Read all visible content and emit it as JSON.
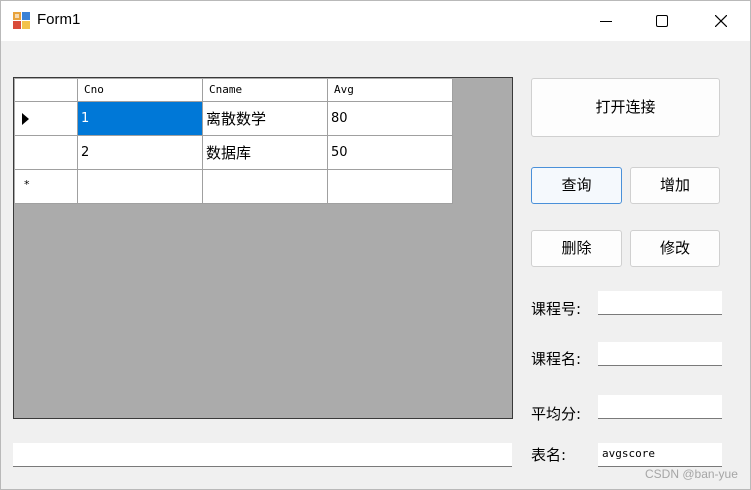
{
  "window": {
    "title": "Form1"
  },
  "titlebar_buttons": {
    "minimize": "minimize-icon",
    "maximize": "maximize-icon",
    "close": "close-icon"
  },
  "grid": {
    "columns": [
      "Cno",
      "Cname",
      "Avg"
    ],
    "rows": [
      {
        "current": true,
        "cells": [
          "1",
          "离散数学",
          "80"
        ]
      },
      {
        "current": false,
        "cells": [
          "2",
          "数据库",
          "50"
        ]
      }
    ],
    "new_row_marker": "*",
    "selected_cell": {
      "row": 0,
      "column": 0
    },
    "colors": {
      "selection": "#0078d7",
      "background": "#ababab"
    }
  },
  "buttons": {
    "open_connection": "打开连接",
    "query": "查询",
    "add": "增加",
    "delete": "删除",
    "modify": "修改"
  },
  "fields": {
    "course_no_label": "课程号:",
    "course_no_value": "",
    "course_name_label": "课程名:",
    "course_name_value": "",
    "average_label": "平均分:",
    "average_value": "",
    "table_name_label": "表名:",
    "table_name_value": "avgscore",
    "bottom_textbox_value": ""
  },
  "watermark": "CSDN @ban-yue"
}
